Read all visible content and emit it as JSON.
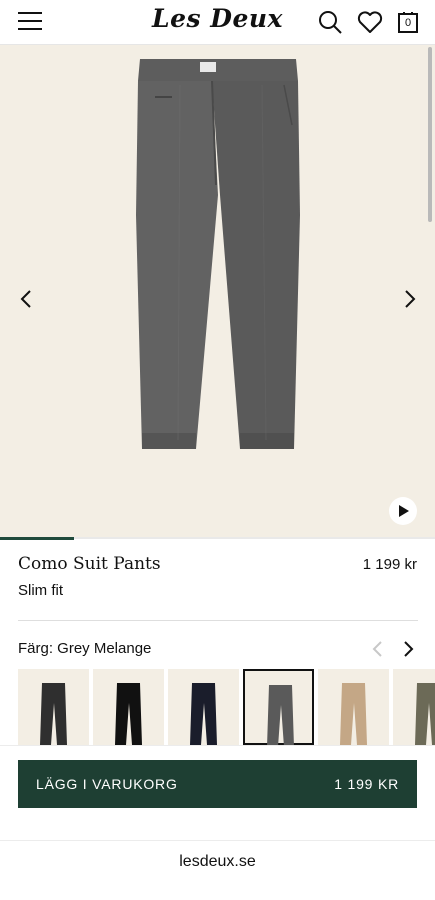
{
  "header": {
    "logo": "Les Deux",
    "cart_count": "0"
  },
  "product": {
    "name": "Como Suit Pants",
    "price": "1 199 kr",
    "fit": "Slim fit",
    "image_progress": 0.17
  },
  "color": {
    "label": "Färg: Grey Melange",
    "swatches": [
      {
        "name": "charcoal",
        "color": "#2f2f2f"
      },
      {
        "name": "black",
        "color": "#111111"
      },
      {
        "name": "navy",
        "color": "#1a1d2b"
      },
      {
        "name": "grey-melange",
        "color": "#5a5a5a",
        "selected": true
      },
      {
        "name": "beige",
        "color": "#c4a786"
      },
      {
        "name": "olive",
        "color": "#6c6a57"
      }
    ]
  },
  "cart_button": {
    "label": "LÄGG I VARUKORG",
    "price": "1 199 KR"
  },
  "footer": {
    "site": "lesdeux.se"
  },
  "colors": {
    "accent": "#1e3f33",
    "image_bg": "#f3eee4"
  }
}
